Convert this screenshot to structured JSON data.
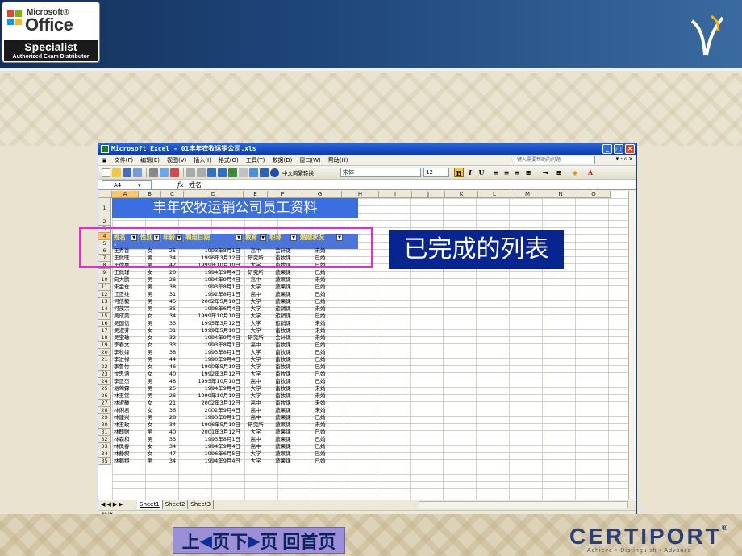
{
  "badge": {
    "brand_small": "Microsoft®",
    "brand_big": "Office",
    "specialist": "Specialist",
    "distributor": "Authorized Exam Distributor"
  },
  "excel": {
    "title": "Microsoft Excel - 01丰年农牧运销公司.xls",
    "menu": [
      "文件(F)",
      "编辑(E)",
      "视图(V)",
      "插入(I)",
      "格式(O)",
      "工具(T)",
      "数据(D)",
      "窗口(W)",
      "帮助(H)"
    ],
    "help_placeholder": "键入需要帮助的问题",
    "toolbar_convert": "中文简繁转换",
    "font_name": "宋体",
    "font_size": "12",
    "name_box": "A4",
    "fx": "fx",
    "formula_value": "姓名",
    "columns": [
      "A",
      "B",
      "C",
      "D",
      "E",
      "F",
      "G",
      "H",
      "I",
      "J",
      "K",
      "L",
      "M",
      "N",
      "O"
    ],
    "sheet_title": "丰年农牧运销公司员工资料",
    "headers": [
      "姓名",
      "性别",
      "年龄",
      "聘用日期",
      "教育",
      "职称",
      "婚姻状况"
    ],
    "rows": [
      [
        "王秀香",
        "女",
        "25",
        "1993年8月1日",
        "高中",
        "会计课",
        "未婚"
      ],
      [
        "王佩旺",
        "男",
        "34",
        "1996年3月12日",
        "研究所",
        "畜牧课",
        "已婚"
      ],
      [
        "王德嘉",
        "男",
        "42",
        "1999年10月10日",
        "大学",
        "畜牧课",
        "已婚"
      ],
      [
        "王佩瑾",
        "女",
        "28",
        "1994年9月4日",
        "研究所",
        "蔬果课",
        "已婚"
      ],
      [
        "向大鹏",
        "男",
        "26",
        "1994年9月4日",
        "高中",
        "蔬果课",
        "未婚"
      ],
      [
        "朱金仓",
        "男",
        "38",
        "1993年8月1日",
        "大学",
        "蔬果课",
        "已婚"
      ],
      [
        "江正维",
        "男",
        "31",
        "1992年8月1日",
        "高中",
        "蔬果课",
        "已婚"
      ],
      [
        "何信毅",
        "男",
        "45",
        "2002年5月10日",
        "大学",
        "蔬果课",
        "已婚"
      ],
      [
        "何茂宗",
        "男",
        "35",
        "1996年6月4日",
        "大学",
        "运销课",
        "未婚"
      ],
      [
        "吴成美",
        "女",
        "34",
        "1999年10月10日",
        "大学",
        "运销课",
        "已婚"
      ],
      [
        "吴国信",
        "男",
        "33",
        "1995年3月12日",
        "大学",
        "运销课",
        "未婚"
      ],
      [
        "吴淑芬",
        "女",
        "31",
        "1999年5月10日",
        "大学",
        "畜牧课",
        "未婚"
      ],
      [
        "吴宝珠",
        "女",
        "32",
        "1994年9月4日",
        "研究所",
        "会计课",
        "未婚"
      ],
      [
        "李春文",
        "女",
        "33",
        "1993年8月1日",
        "高中",
        "畜牧课",
        "已婚"
      ],
      [
        "李秋缘",
        "男",
        "38",
        "1993年8月1日",
        "大学",
        "畜牧课",
        "已婚"
      ],
      [
        "李进禄",
        "男",
        "44",
        "1990年9月4日",
        "大学",
        "畜牧课",
        "已婚"
      ],
      [
        "李鲁竹",
        "女",
        "46",
        "1990年5月10日",
        "大学",
        "畜牧课",
        "已婚"
      ],
      [
        "沈思涵",
        "女",
        "40",
        "1992年3月12日",
        "大学",
        "畜牧课",
        "已婚"
      ],
      [
        "李正杰",
        "男",
        "48",
        "1995年10月10日",
        "高中",
        "畜牧课",
        "已婚"
      ],
      [
        "易莺霖",
        "男",
        "25",
        "1994年9月4日",
        "大学",
        "畜牧课",
        "未婚"
      ],
      [
        "林玉堂",
        "男",
        "26",
        "1999年10月10日",
        "大学",
        "畜牧课",
        "未婚"
      ],
      [
        "林淑静",
        "女",
        "21",
        "2002年3月12日",
        "高中",
        "畜牧课",
        "未婚"
      ],
      [
        "林俐君",
        "女",
        "36",
        "2002年9月4日",
        "高中",
        "蔬果课",
        "未婚"
      ],
      [
        "林建兴",
        "男",
        "28",
        "1993年8月1日",
        "高中",
        "蔬果课",
        "已婚"
      ],
      [
        "林玉玫",
        "女",
        "34",
        "1996年5月10日",
        "研究所",
        "蔬果课",
        "未婚"
      ],
      [
        "林麒财",
        "男",
        "40",
        "2001年3月12日",
        "大学",
        "蔬果课",
        "已婚"
      ],
      [
        "林森和",
        "男",
        "33",
        "1993年8月1日",
        "高中",
        "蔬果课",
        "已婚"
      ],
      [
        "林凤春",
        "女",
        "34",
        "1994年9月4日",
        "高中",
        "蔬果课",
        "已婚"
      ],
      [
        "林静叙",
        "女",
        "47",
        "1996年6月5日",
        "大学",
        "蔬果课",
        "已婚"
      ],
      [
        "林鹏翔",
        "男",
        "34",
        "1994年9月4日",
        "大学",
        "蔬果课",
        "已婚"
      ]
    ],
    "sheets": [
      "Sheet1",
      "Sheet2",
      "Sheet3"
    ],
    "status": "就绪"
  },
  "callout": "已完成的列表",
  "nav": {
    "prev": "上",
    "page1": "页",
    "next": "下",
    "page2": "页",
    "home": "回首页"
  },
  "certiport": {
    "name": "CERTIPORT",
    "tagline": "Achieve • Distinguish • Advance"
  }
}
